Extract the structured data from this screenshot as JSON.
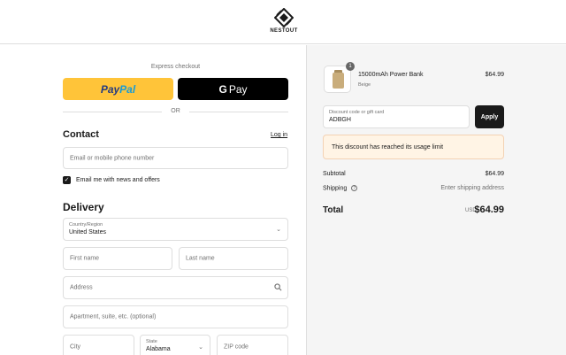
{
  "header": {
    "brand": "NESTOUT"
  },
  "express": {
    "label": "Express checkout",
    "paypal_label_a": "Pay",
    "paypal_label_b": "Pal",
    "gpay_g": "G",
    "gpay_label": "Pay",
    "or_label": "OR"
  },
  "contact": {
    "title": "Contact",
    "login_label": "Log in",
    "email_placeholder": "Email or mobile phone number",
    "newsletter_label": "Email me with news and offers",
    "newsletter_checked": true
  },
  "delivery": {
    "title": "Delivery",
    "country_label": "Country/Region",
    "country_value": "United States",
    "first_name_placeholder": "First name",
    "last_name_placeholder": "Last name",
    "address_placeholder": "Address",
    "apartment_placeholder": "Apartment, suite, etc. (optional)",
    "city_placeholder": "City",
    "state_label": "State",
    "state_value": "Alabama",
    "zip_placeholder": "ZIP code"
  },
  "summary": {
    "product": {
      "name": "15000mAh Power Bank",
      "variant": "Beige",
      "price": "$64.99",
      "quantity": "1"
    },
    "discount_label": "Discount code or gift card",
    "discount_value": "ADBGH",
    "apply_label": "Apply",
    "notice": "This discount has reached its usage limit",
    "subtotal_label": "Subtotal",
    "subtotal_value": "$64.99",
    "shipping_label": "Shipping",
    "shipping_help": "?",
    "shipping_value": "Enter shipping address",
    "total_label": "Total",
    "total_currency": "USD",
    "total_value": "$64.99"
  },
  "icons": {
    "logo": "nestout-logo-icon",
    "search": "search-icon",
    "chevron": "chevron-down-icon",
    "check": "check-icon"
  },
  "colors": {
    "paypal": "#ffc439",
    "gpay": "#000000",
    "apply": "#1a1a1a",
    "notice_bg": "#fff4e5"
  }
}
